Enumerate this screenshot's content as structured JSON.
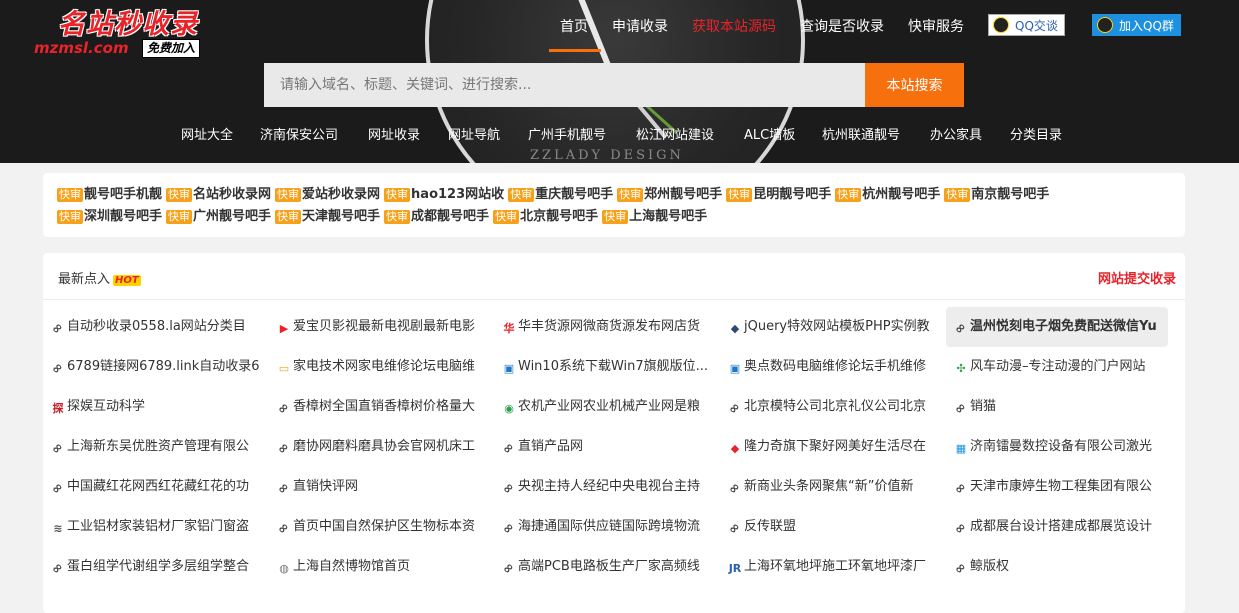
{
  "logo": {
    "title": "名站秒收录",
    "domain": "mzmsl.com",
    "badge": "免费加入"
  },
  "banner_text": "ZZLADY DESIGN",
  "nav": [
    {
      "label": "首页",
      "color": "#ffffff"
    },
    {
      "label": "申请收录",
      "color": "#ffffff"
    },
    {
      "label": "获取本站源码",
      "color": "#e8232a"
    },
    {
      "label": "查询是否收录",
      "color": "#ffffff"
    },
    {
      "label": "快审服务",
      "color": "#ffffff"
    }
  ],
  "qq_buttons": {
    "chat": "QQ交谈",
    "group": "加入QQ群"
  },
  "search": {
    "placeholder": "请输入域名、标题、关键词、进行搜索...",
    "button": "本站搜索"
  },
  "subnav": [
    "网址大全",
    "济南保安公司",
    "网址收录",
    "网址导航",
    "广州手机靓号",
    "松江网站建设",
    "ALC墙板",
    "杭州联通靓号",
    "办公家具",
    "分类目录"
  ],
  "quick": {
    "badge": "快审",
    "row1": [
      "靓号吧手机靓",
      "名站秒收录网",
      "爱站秒收录网",
      "hao123网站收",
      "重庆靓号吧手",
      "郑州靓号吧手",
      "昆明靓号吧手",
      "杭州靓号吧手",
      "南京靓号吧手"
    ],
    "row2": [
      "深圳靓号吧手",
      "广州靓号吧手",
      "天津靓号吧手",
      "成都靓号吧手",
      "北京靓号吧手",
      "上海靓号吧手"
    ]
  },
  "latest": {
    "title": "最新点入",
    "hot": "HOT",
    "submit": "网站提交收录",
    "rows": [
      [
        {
          "icon": "link-icon",
          "text": "自动秒收录0558.la网站分类目"
        },
        {
          "icon": "video-icon",
          "text": "爱宝贝影视最新电视剧最新电影"
        },
        {
          "icon": "hua-logo-icon",
          "text": "华丰货源网微商货源发布网店货"
        },
        {
          "icon": "site-logo-icon",
          "text": "jQuery特效网站模板PHP实例教"
        },
        {
          "icon": "link-icon",
          "text": "温州悦刻电子烟免费配送微信Yu",
          "highlight": true
        }
      ],
      [
        {
          "icon": "link-icon",
          "text": "6789链接网6789.link自动收录6"
        },
        {
          "icon": "folder-icon",
          "text": "家电技术网家电维修论坛电脑维"
        },
        {
          "icon": "monitor-icon",
          "text": "Win10系统下载Win7旗舰版位..."
        },
        {
          "icon": "monitor-icon",
          "text": "奥点数码电脑维修论坛手机维修"
        },
        {
          "icon": "pinwheel-icon",
          "text": "风车动漫–专注动漫的门户网站"
        }
      ],
      [
        {
          "icon": "red-logo-icon",
          "text": "探娱互动科学"
        },
        {
          "icon": "link-icon",
          "text": "香樟树全国直销香樟树价格量大"
        },
        {
          "icon": "globe-icon",
          "text": "农机产业网农业机械产业网是粮"
        },
        {
          "icon": "link-icon",
          "text": "北京模特公司北京礼仪公司北京"
        },
        {
          "icon": "link-icon",
          "text": "销猫"
        }
      ],
      [
        {
          "icon": "link-icon",
          "text": "上海新东吴优胜资产管理有限公"
        },
        {
          "icon": "link-icon",
          "text": "磨协网磨料磨具协会官网机床工"
        },
        {
          "icon": "link-icon",
          "text": "直销产品网"
        },
        {
          "icon": "diamond-logo-icon",
          "text": "隆力奇旗下聚好网美好生活尽在"
        },
        {
          "icon": "building-icon",
          "text": "济南镭曼数控设备有限公司激光"
        }
      ],
      [
        {
          "icon": "link-icon",
          "text": "中国藏红花网西红花藏红花的功"
        },
        {
          "icon": "link-icon",
          "text": "直销快评网"
        },
        {
          "icon": "link-icon",
          "text": "央视主持人经纪中央电视台主持"
        },
        {
          "icon": "link-icon",
          "text": "新商业头条网聚焦“新”价值新"
        },
        {
          "icon": "link-icon",
          "text": "天津市康婷生物工程集团有限公"
        }
      ],
      [
        {
          "icon": "stack-icon",
          "text": "工业铝材家装铝材厂家铝门窗盗"
        },
        {
          "icon": "link-icon",
          "text": "首页中国自然保护区生物标本资"
        },
        {
          "icon": "link-icon",
          "text": "海捷通国际供应链国际跨境物流"
        },
        {
          "icon": "link-icon",
          "text": "反传联盟"
        },
        {
          "icon": "link-icon",
          "text": "成都展台设计搭建成都展览设计"
        }
      ],
      [
        {
          "icon": "link-icon",
          "text": "蛋白组学代谢组学多层组学整合"
        },
        {
          "icon": "museum-icon",
          "text": "上海自然博物馆首页"
        },
        {
          "icon": "link-icon",
          "text": "高端PCB电路板生产厂家高频线"
        },
        {
          "icon": "jr-logo-icon",
          "text": "上海环氧地坪施工环氧地坪漆厂"
        },
        {
          "icon": "link-icon",
          "text": "鲸版权"
        }
      ]
    ]
  }
}
